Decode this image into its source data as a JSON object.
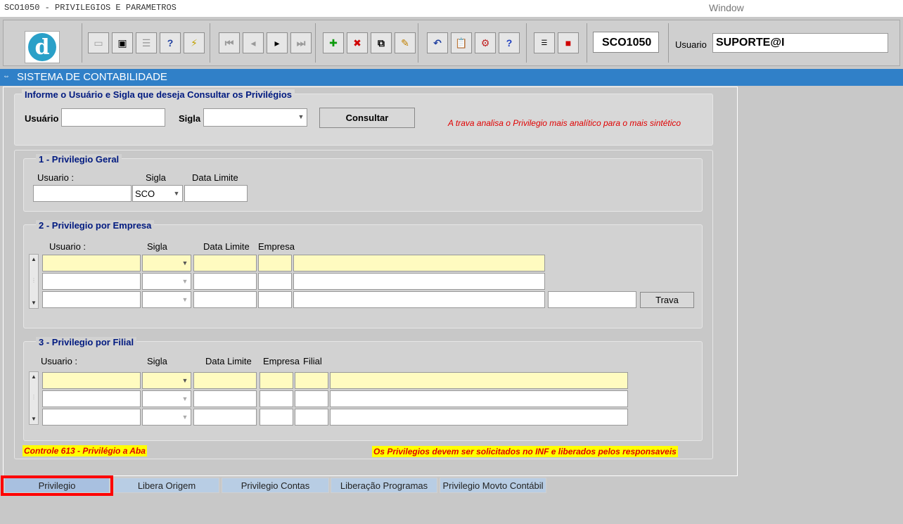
{
  "window": {
    "title": "SCO1050 - PRIVILEGIOS E PARAMETROS",
    "menu": "Window"
  },
  "toolbar": {
    "form_code": "SCO1050",
    "usuario_label": "Usuario",
    "usuario_value": "SUPORTE@I"
  },
  "header": {
    "system": "SISTEMA DE CONTABILIDADE"
  },
  "query": {
    "legend": "Informe o Usuário e Sigla que deseja Consultar os Privilégios",
    "usuario_label": "Usuário",
    "sigla_label": "Sigla",
    "consultar_label": "Consultar",
    "note": "A trava analisa o Privilegio mais analítico para o mais sintético"
  },
  "geral": {
    "legend": "1 - Privilegio Geral",
    "col_usuario": "Usuario :",
    "col_sigla": "Sigla",
    "col_data": "Data Limite",
    "sigla_value": "SCO"
  },
  "empresa": {
    "legend": "2 - Privilegio por Empresa",
    "col_usuario": "Usuario :",
    "col_sigla": "Sigla",
    "col_data": "Data Limite",
    "col_empresa": "Empresa",
    "trava_label": "Trava"
  },
  "filial": {
    "legend": "3 - Privilegio por Filial",
    "col_usuario": "Usuario :",
    "col_sigla": "Sigla",
    "col_data": "Data Limite",
    "col_empresa": "Empresa",
    "col_filial": "Filial"
  },
  "footer": {
    "left_note": "Controle 613 - Privilégio a Aba",
    "right_note": "Os Privilegios devem ser solicitados no INF e liberados pelos responsaveis"
  },
  "tabs": [
    "Privilegio",
    "Libera Origem",
    "Privilegio Contas",
    "Liberação Programas",
    "Privilegio Movto Contábil"
  ]
}
